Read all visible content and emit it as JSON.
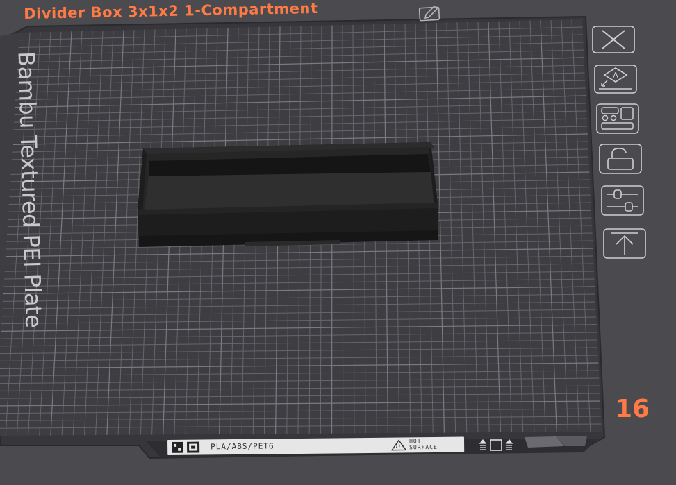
{
  "plate": {
    "title": "Divider Box 3x1x2 1-Compartment",
    "brand_text": "Bambu Textured PEI Plate",
    "number": "16",
    "label": {
      "materials": "PLA/ABS/PETG",
      "warning_line1": "HOT",
      "warning_line2": "SURFACE"
    }
  },
  "toolbar": [
    {
      "icon": "close-icon"
    },
    {
      "icon": "auto-orient-icon"
    },
    {
      "icon": "arrange-icon"
    },
    {
      "icon": "unlock-icon"
    },
    {
      "icon": "plate-settings-icon"
    },
    {
      "icon": "move-to-top-icon"
    }
  ],
  "colors": {
    "background": "#4a4a4f",
    "plate": "#3c3c41",
    "grid": "#6e6e74",
    "accent": "#ff7a45",
    "model": "#1f1f1f",
    "icon_stroke": "#cfcfd3"
  }
}
